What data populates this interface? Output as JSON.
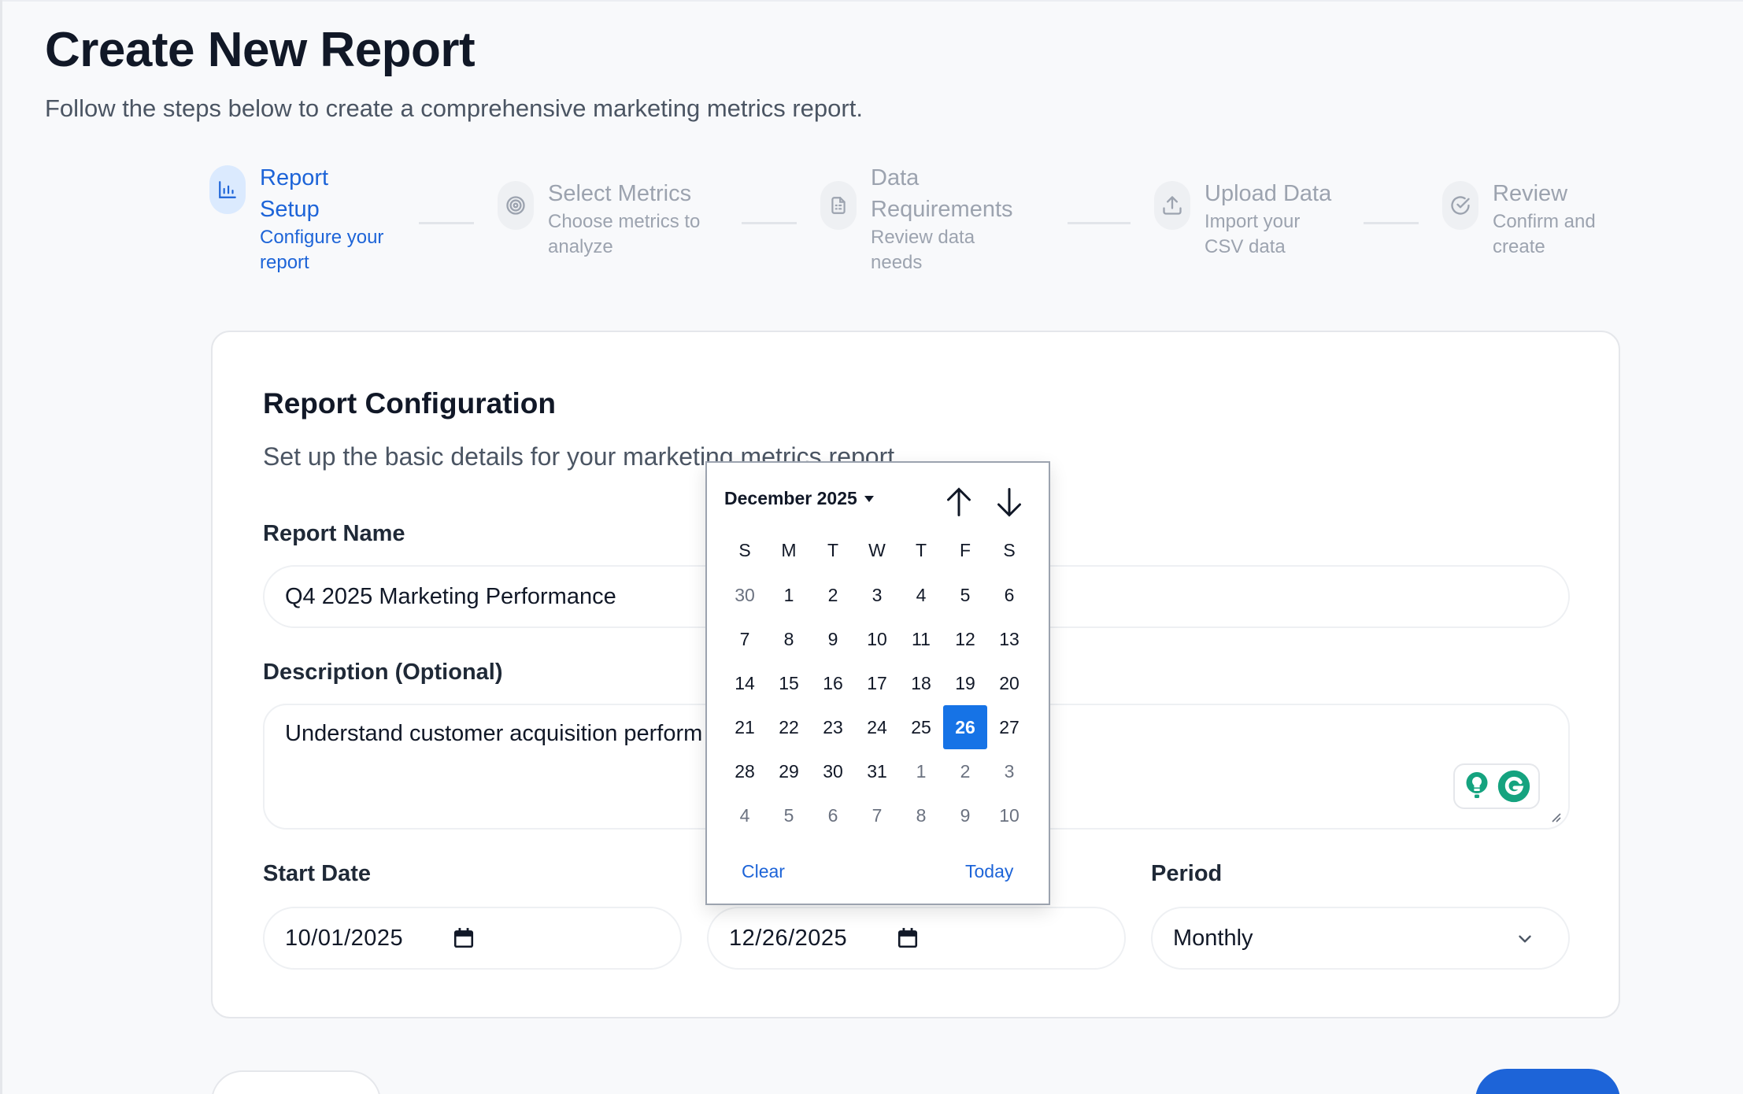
{
  "header": {
    "title": "Create New Report",
    "subtitle": "Follow the steps below to create a comprehensive marketing metrics report."
  },
  "stepper": {
    "steps": [
      {
        "title_line1": "Report",
        "title_line2": "Setup",
        "desc_line1": "Configure your",
        "desc_line2": "report",
        "icon": "bar-chart-icon",
        "state": "active"
      },
      {
        "title_line1": "Select Metrics",
        "title_line2": "",
        "desc_line1": "Choose metrics to",
        "desc_line2": "analyze",
        "icon": "target-icon",
        "state": "inactive"
      },
      {
        "title_line1": "Data",
        "title_line2": "Requirements",
        "desc_line1": "Review data",
        "desc_line2": "needs",
        "icon": "document-icon",
        "state": "inactive"
      },
      {
        "title_line1": "Upload Data",
        "title_line2": "",
        "desc_line1": "Import your",
        "desc_line2": "CSV data",
        "icon": "upload-icon",
        "state": "inactive"
      },
      {
        "title_line1": "Review",
        "title_line2": "",
        "desc_line1": "Confirm and",
        "desc_line2": "create",
        "icon": "check-circle-icon",
        "state": "inactive"
      }
    ]
  },
  "form": {
    "title": "Report Configuration",
    "subtitle": "Set up the basic details for your marketing metrics report.",
    "report_name": {
      "label": "Report Name",
      "value": "Q4 2025 Marketing Performance"
    },
    "description": {
      "label": "Description (Optional)",
      "value": "Understand customer acquisition perform"
    },
    "start_date": {
      "label": "Start Date",
      "value": "10/01/2025"
    },
    "end_date": {
      "value": "12/26/2025"
    },
    "period": {
      "label": "Period",
      "value": "Monthly"
    }
  },
  "calendar": {
    "month_label": "December 2025",
    "weekdays": [
      "S",
      "M",
      "T",
      "W",
      "T",
      "F",
      "S"
    ],
    "weeks": [
      [
        {
          "d": "30",
          "m": true
        },
        {
          "d": "1"
        },
        {
          "d": "2"
        },
        {
          "d": "3"
        },
        {
          "d": "4"
        },
        {
          "d": "5"
        },
        {
          "d": "6"
        }
      ],
      [
        {
          "d": "7"
        },
        {
          "d": "8"
        },
        {
          "d": "9"
        },
        {
          "d": "10"
        },
        {
          "d": "11"
        },
        {
          "d": "12"
        },
        {
          "d": "13"
        }
      ],
      [
        {
          "d": "14"
        },
        {
          "d": "15"
        },
        {
          "d": "16"
        },
        {
          "d": "17"
        },
        {
          "d": "18"
        },
        {
          "d": "19"
        },
        {
          "d": "20"
        }
      ],
      [
        {
          "d": "21"
        },
        {
          "d": "22"
        },
        {
          "d": "23"
        },
        {
          "d": "24"
        },
        {
          "d": "25"
        },
        {
          "d": "26",
          "sel": true
        },
        {
          "d": "27"
        }
      ],
      [
        {
          "d": "28"
        },
        {
          "d": "29"
        },
        {
          "d": "30"
        },
        {
          "d": "31"
        },
        {
          "d": "1",
          "m": true
        },
        {
          "d": "2",
          "m": true
        },
        {
          "d": "3",
          "m": true
        }
      ],
      [
        {
          "d": "4",
          "m": true
        },
        {
          "d": "5",
          "m": true
        },
        {
          "d": "6",
          "m": true
        },
        {
          "d": "7",
          "m": true
        },
        {
          "d": "8",
          "m": true
        },
        {
          "d": "9",
          "m": true
        },
        {
          "d": "10",
          "m": true
        }
      ]
    ],
    "clear_label": "Clear",
    "today_label": "Today"
  },
  "colors": {
    "accent": "#1d64d8",
    "selected_day": "#1673e6",
    "grammarly_green": "#15a37f"
  }
}
